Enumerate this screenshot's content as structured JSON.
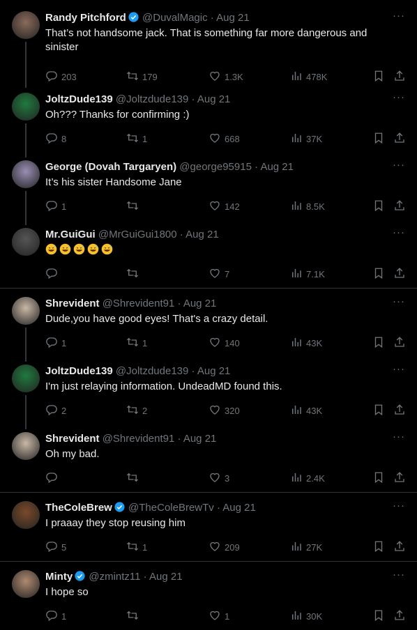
{
  "colors": {
    "background": "#000000",
    "text": "#e7e9ea",
    "muted": "#71767b",
    "verified": "#1d9bf0",
    "divider": "#2f3336"
  },
  "tweets": [
    {
      "name": "Randy Pitchford",
      "verified": true,
      "handle": "@DuvalMagic",
      "date": "· Aug 21",
      "text": "That’s not handsome jack. That is something far more dangerous and sinister",
      "replies": "203",
      "retweets": "179",
      "likes": "1.3K",
      "views": "478K"
    },
    {
      "name": "JoltzDude139",
      "verified": false,
      "handle": "@Joltzdude139",
      "date": "· Aug 21",
      "text": "Oh??? Thanks for confirming :)",
      "replies": "8",
      "retweets": "1",
      "likes": "668",
      "views": "37K"
    },
    {
      "name": "George (Dovah Targaryen)",
      "verified": false,
      "handle": "@george95915",
      "date": "· Aug 21",
      "text": "It’s his sister Handsome Jane",
      "replies": "1",
      "retweets": "",
      "likes": "142",
      "views": "8.5K"
    },
    {
      "name": "Mr.GuiGui",
      "verified": false,
      "handle": "@MrGuiGui1800",
      "date": "· Aug 21",
      "text": "",
      "emoji": "grinning-sweat-face-icon",
      "emoji_count": 5,
      "replies": "",
      "retweets": "",
      "likes": "7",
      "views": "7.1K"
    },
    {
      "name": "Shrevident",
      "verified": false,
      "handle": "@Shrevident91",
      "date": "· Aug 21",
      "text": "Dude,you have good eyes! That's a crazy detail.",
      "replies": "1",
      "retweets": "1",
      "likes": "140",
      "views": "43K"
    },
    {
      "name": "JoltzDude139",
      "verified": false,
      "handle": "@Joltzdude139",
      "date": "· Aug 21",
      "text": "I'm just relaying information. UndeadMD found this.",
      "replies": "2",
      "retweets": "2",
      "likes": "320",
      "views": "43K"
    },
    {
      "name": "Shrevident",
      "verified": false,
      "handle": "@Shrevident91",
      "date": "· Aug 21",
      "text": "Oh my bad.",
      "replies": "",
      "retweets": "",
      "likes": "3",
      "views": "2.4K"
    },
    {
      "name": "TheColeBrew",
      "verified": true,
      "handle": "@TheColeBrewTv",
      "date": "· Aug 21",
      "text": "I praaay they stop reusing him",
      "replies": "5",
      "retweets": "1",
      "likes": "209",
      "views": "27K"
    },
    {
      "name": "Minty",
      "verified": true,
      "handle": "@zmintz11",
      "date": "· Aug 21",
      "text": "I hope so",
      "replies": "1",
      "retweets": "",
      "likes": "1",
      "views": "30K"
    }
  ],
  "more_label": "···"
}
